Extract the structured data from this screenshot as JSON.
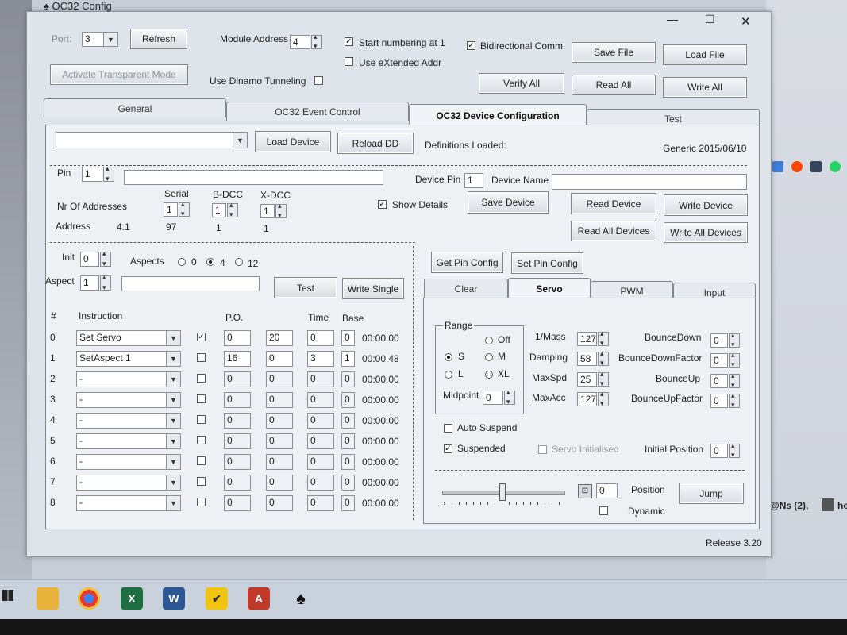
{
  "window": {
    "title": "OC32 Config",
    "release": "Release 3.20"
  },
  "titlebar": {
    "minimize": "—",
    "maximize": "☐",
    "close": "✕"
  },
  "top": {
    "port_label": "Port:",
    "port_value": "3",
    "refresh": "Refresh",
    "module_address_label": "Module Address",
    "module_address_value": "4",
    "start_numbering": "Start numbering at 1",
    "use_extended": "Use eXtended Addr",
    "bidirectional": "Bidirectional Comm.",
    "save_file": "Save File",
    "load_file": "Load File",
    "activate_transparent": "Activate Transparent Mode",
    "use_dinamo": "Use Dinamo Tunneling",
    "verify_all": "Verify All",
    "read_all": "Read All",
    "write_all": "Write All"
  },
  "tabs": [
    "General",
    "OC32 Event Control",
    "OC32 Device Configuration",
    "Test"
  ],
  "device": {
    "load_device": "Load Device",
    "reload_dd": "Reload DD",
    "definitions_loaded": "Definitions Loaded:",
    "generic": "Generic 2015/06/10",
    "pin_label": "Pin",
    "pin_value": "1",
    "device_pin_label": "Device Pin",
    "device_pin_value": "1",
    "device_name_label": "Device Name",
    "serial_label": "Serial",
    "bdcc_label": "B-DCC",
    "xdcc_label": "X-DCC",
    "nr_addresses_label": "Nr Of Addresses",
    "serial_value": "1",
    "bdcc_value": "1",
    "xdcc_value": "1",
    "show_details": "Show Details",
    "save_device": "Save Device",
    "read_device": "Read Device",
    "write_device": "Write Device",
    "address_label": "Address",
    "address_value": "4.1",
    "address_serial": "97",
    "address_bdcc": "1",
    "address_xdcc": "1",
    "read_all_devices": "Read All Devices",
    "write_all_devices": "Write All Devices"
  },
  "aspect": {
    "init_label": "Init",
    "init_value": "0",
    "aspects_label": "Aspects",
    "aspect_opts": [
      "0",
      "4",
      "12"
    ],
    "aspect_label": "Aspect",
    "aspect_value": "1",
    "test": "Test",
    "write_single": "Write Single"
  },
  "table": {
    "headers": {
      "num": "#",
      "instruction": "Instruction",
      "po": "P.O.",
      "time": "Time",
      "base": "Base"
    },
    "rows": [
      {
        "n": "0",
        "instr": "Set Servo",
        "checked": true,
        "a": "0",
        "b": "20",
        "c": "0",
        "d": "0",
        "t": "00:00.00"
      },
      {
        "n": "1",
        "instr": "SetAspect 1",
        "checked": false,
        "a": "16",
        "b": "0",
        "c": "3",
        "d": "1",
        "t": "00:00.48"
      },
      {
        "n": "2",
        "instr": "-",
        "checked": false,
        "a": "0",
        "b": "0",
        "c": "0",
        "d": "0",
        "t": "00:00.00"
      },
      {
        "n": "3",
        "instr": "-",
        "checked": false,
        "a": "0",
        "b": "0",
        "c": "0",
        "d": "0",
        "t": "00:00.00"
      },
      {
        "n": "4",
        "instr": "-",
        "checked": false,
        "a": "0",
        "b": "0",
        "c": "0",
        "d": "0",
        "t": "00:00.00"
      },
      {
        "n": "5",
        "instr": "-",
        "checked": false,
        "a": "0",
        "b": "0",
        "c": "0",
        "d": "0",
        "t": "00:00.00"
      },
      {
        "n": "6",
        "instr": "-",
        "checked": false,
        "a": "0",
        "b": "0",
        "c": "0",
        "d": "0",
        "t": "00:00.00"
      },
      {
        "n": "7",
        "instr": "-",
        "checked": false,
        "a": "0",
        "b": "0",
        "c": "0",
        "d": "0",
        "t": "00:00.00"
      },
      {
        "n": "8",
        "instr": "-",
        "checked": false,
        "a": "0",
        "b": "0",
        "c": "0",
        "d": "0",
        "t": "00:00.00"
      }
    ]
  },
  "pin_config": {
    "get": "Get Pin Config",
    "set": "Set Pin Config"
  },
  "subtabs": [
    "Clear",
    "Servo",
    "PWM",
    "Input"
  ],
  "servo": {
    "range_label": "Range",
    "off": "Off",
    "s": "S",
    "m": "M",
    "l": "L",
    "xl": "XL",
    "midpoint_label": "Midpoint",
    "midpoint_value": "0",
    "mass_label": "1/Mass",
    "mass_value": "127",
    "damping_label": "Damping",
    "damping_value": "58",
    "maxspd_label": "MaxSpd",
    "maxspd_value": "25",
    "maxacc_label": "MaxAcc",
    "maxacc_value": "127",
    "bouncedown_label": "BounceDown",
    "bouncedown_value": "0",
    "bouncedownfactor_label": "BounceDownFactor",
    "bouncedownfactor_value": "0",
    "bounceup_label": "BounceUp",
    "bounceup_value": "0",
    "bounceupfactor_label": "BounceUpFactor",
    "bounceupfactor_value": "0",
    "auto_suspend": "Auto Suspend",
    "suspended": "Suspended",
    "servo_initialised": "Servo Initialised",
    "initial_position_label": "Initial Position",
    "initial_position_value": "0",
    "position_label": "Position",
    "position_value": "0",
    "dynamic": "Dynamic",
    "jump": "Jump",
    "slider_level": 0.5
  },
  "background_text": {
    "mentions": "@Ns (2),",
    "he": "he"
  },
  "colors": {
    "window_bg": "#dfe3ea",
    "accent_red": "#c0392b"
  }
}
